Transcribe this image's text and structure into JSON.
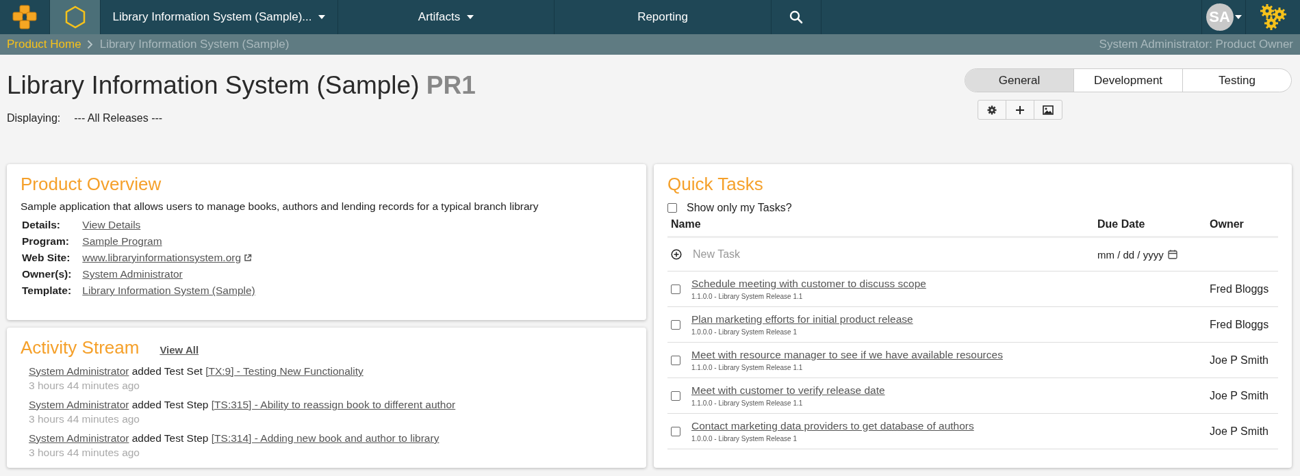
{
  "nav": {
    "product": "Library Information System (Sample)...",
    "artifacts": "Artifacts",
    "reporting": "Reporting",
    "avatar": "SA"
  },
  "breadcrumb": {
    "home": "Product Home",
    "current": "Library Information System (Sample)",
    "role": "System Administrator: Product Owner"
  },
  "page": {
    "title": "Library Information System (Sample)",
    "token": "PR1",
    "displaying_label": "Displaying:",
    "displaying_value": "--- All Releases ---"
  },
  "view_tabs": [
    {
      "label": "General",
      "selected": true
    },
    {
      "label": "Development",
      "selected": false
    },
    {
      "label": "Testing",
      "selected": false
    }
  ],
  "overview": {
    "heading": "Product Overview",
    "description": "Sample application that allows users to manage books, authors and lending records for a typical branch library",
    "fields": [
      {
        "label": "Details:",
        "value": "View Details",
        "external": false
      },
      {
        "label": "Program:",
        "value": "Sample Program",
        "external": false
      },
      {
        "label": "Web Site:",
        "value": "www.libraryinformationsystem.org",
        "external": true
      },
      {
        "label": "Owner(s):",
        "value": "System Administrator",
        "external": false
      },
      {
        "label": "Template:",
        "value": "Library Information System (Sample)",
        "external": false
      }
    ]
  },
  "activity": {
    "heading": "Activity Stream",
    "view_all": "View All",
    "items": [
      {
        "user": "System Administrator",
        "action": "added Test Set",
        "artifact": "[TX:9] - Testing New Functionality",
        "time": "3 hours 44 minutes ago"
      },
      {
        "user": "System Administrator",
        "action": "added Test Step",
        "artifact": "[TS:315] - Ability to reassign book to different author",
        "time": "3 hours 44 minutes ago"
      },
      {
        "user": "System Administrator",
        "action": "added Test Step",
        "artifact": "[TS:314] - Adding new book and author to library",
        "time": "3 hours 44 minutes ago"
      }
    ]
  },
  "quick_tasks": {
    "heading": "Quick Tasks",
    "filter": {
      "label": "Show only my Tasks?",
      "checked": false
    },
    "columns": [
      "Name",
      "Due Date",
      "Owner"
    ],
    "new_task": {
      "placeholder": "New Task",
      "date_placeholder": "mm / dd / yyyy"
    },
    "tasks": [
      {
        "name": "Schedule meeting with customer to discuss scope",
        "release": "1.1.0.0 - Library System Release 1.1",
        "owner": "Fred Bloggs",
        "checked": false
      },
      {
        "name": "Plan marketing efforts for initial product release",
        "release": "1.0.0.0 - Library System Release 1",
        "owner": "Fred Bloggs",
        "checked": false
      },
      {
        "name": "Meet with resource manager to see if we have available resources",
        "release": "1.1.0.0 - Library System Release 1.1",
        "owner": "Joe P Smith",
        "checked": false
      },
      {
        "name": "Meet with customer to verify release date",
        "release": "1.1.0.0 - Library System Release 1.1",
        "owner": "Joe P Smith",
        "checked": false
      },
      {
        "name": "Contact marketing data providers to get database of authors",
        "release": "1.0.0.0 - Library System Release 1",
        "owner": "Joe P Smith",
        "checked": false
      }
    ]
  }
}
